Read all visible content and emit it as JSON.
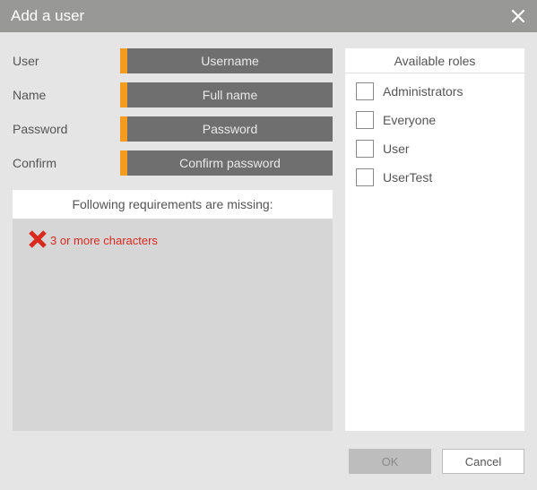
{
  "dialog": {
    "title": "Add a user"
  },
  "form": {
    "user": {
      "label": "User",
      "placeholder": "Username"
    },
    "name": {
      "label": "Name",
      "placeholder": "Full name"
    },
    "password": {
      "label": "Password",
      "placeholder": "Password"
    },
    "confirm": {
      "label": "Confirm",
      "placeholder": "Confirm password"
    }
  },
  "requirements": {
    "header": "Following requirements are missing:",
    "items": [
      {
        "text": "3 or more characters"
      }
    ]
  },
  "roles": {
    "header": "Available roles",
    "items": [
      {
        "label": "Administrators"
      },
      {
        "label": "Everyone"
      },
      {
        "label": "User"
      },
      {
        "label": "UserTest"
      }
    ]
  },
  "buttons": {
    "ok": "OK",
    "cancel": "Cancel"
  },
  "colors": {
    "accent": "#f39c1f",
    "error": "#d82a1f"
  }
}
